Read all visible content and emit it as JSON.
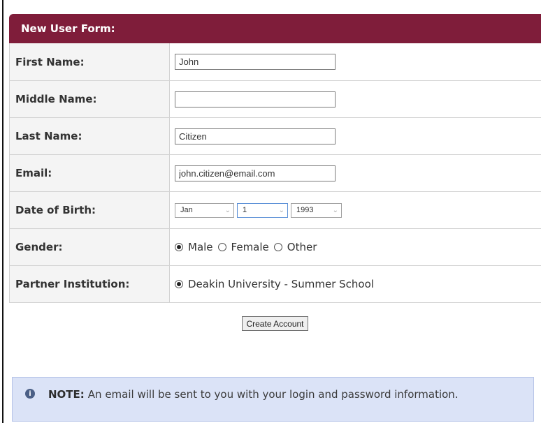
{
  "form": {
    "title": "New User Form:",
    "fields": [
      {
        "label": "First Name:",
        "value": ""
      },
      {
        "label": "Middle Name:",
        "value": ""
      },
      {
        "label": "Last Name:",
        "value": ""
      },
      {
        "label": "Email:",
        "value": ""
      }
    ],
    "dob": {
      "label": "Date of Birth:",
      "month": "Jan",
      "day": "1",
      "year": "1993"
    },
    "gender": {
      "label": "Gender:",
      "options": [
        "Male",
        "Female",
        "Other"
      ],
      "selected": "Male"
    },
    "partner": {
      "label": "Partner Institution:",
      "option": "Deakin University - Summer School"
    },
    "submit_label": "Create Account"
  },
  "values": {
    "first_name": "John",
    "middle_name": "",
    "last_name": "Citizen",
    "email": "john.citizen@email.com"
  },
  "note": {
    "label": "NOTE:",
    "text": "An email will be sent to you with your login and password information."
  },
  "colors": {
    "header_bg": "#7f1d3a",
    "note_bg": "#dbe3f7"
  },
  "icons": {
    "note_icon": "info-icon",
    "select_arrow": "chevron-down-icon"
  }
}
